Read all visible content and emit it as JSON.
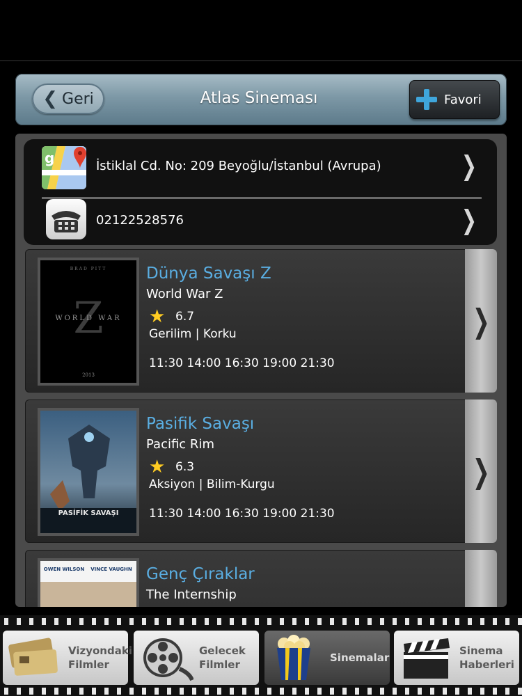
{
  "header": {
    "back_label": "Geri",
    "title": "Atlas Sineması",
    "favorite_label": "Favori"
  },
  "info": {
    "address": "İstiklal Cd. No: 209 Beyoğlu/İstanbul (Avrupa)",
    "phone": "02122528576"
  },
  "movies": [
    {
      "title": "Dünya Savaşı Z",
      "original_title": "World War Z",
      "rating": "6.7",
      "genre": "Gerilim | Korku",
      "times": "11:30 14:00 16:30 19:00 21:30",
      "poster_text": {
        "top": "BRAD PITT",
        "main": "WORLD WAR",
        "letter": "Z",
        "year": "2013"
      }
    },
    {
      "title": "Pasifik Savaşı",
      "original_title": "Pacific Rim",
      "rating": "6.3",
      "genre": "Aksiyon | Bilim-Kurgu",
      "times": "11:30 14:00 16:30 19:00 21:30",
      "poster_text": {
        "main": "PASİFİK SAVAŞI"
      }
    },
    {
      "title": "Genç Çıraklar",
      "original_title": "The Internship",
      "poster_text": {
        "left": "OWEN WILSON",
        "right": "VINCE VAUGHN"
      }
    }
  ],
  "tabs": [
    {
      "label_1": "Vizyondaki",
      "label_2": "Filmler",
      "icon": "ticket-icon"
    },
    {
      "label_1": "Gelecek",
      "label_2": "Filmler",
      "icon": "film-reel-icon"
    },
    {
      "label_1": "Sinemalar",
      "label_2": "",
      "icon": "popcorn-icon"
    },
    {
      "label_1": "Sinema",
      "label_2": "Haberleri",
      "icon": "clapperboard-icon"
    }
  ],
  "colors": {
    "accent_title": "#5aaee2",
    "favorite_plus": "#3fa6dc",
    "star": "#ffcc22"
  }
}
